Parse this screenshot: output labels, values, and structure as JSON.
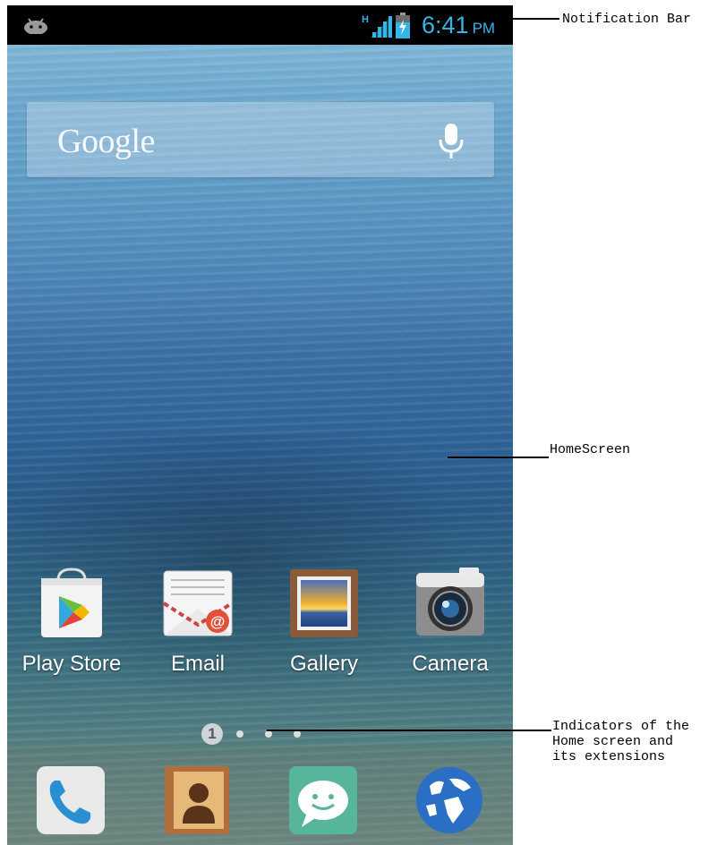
{
  "status_bar": {
    "time": "6:41",
    "ampm": "PM",
    "network_type": "H",
    "icons": [
      "android-notification-icon",
      "hspa-icon",
      "signal-icon",
      "battery-charging-icon"
    ],
    "accent_color": "#33b5e5"
  },
  "search_widget": {
    "logo": "Google",
    "icon": "mic-icon"
  },
  "apps": [
    {
      "label": "Play Store",
      "icon": "play-store-icon"
    },
    {
      "label": "Email",
      "icon": "email-icon"
    },
    {
      "label": "Gallery",
      "icon": "gallery-icon"
    },
    {
      "label": "Camera",
      "icon": "camera-icon"
    }
  ],
  "page_indicator": {
    "current_page": "1",
    "total_pages": 4
  },
  "dock": [
    {
      "icon": "phone-icon"
    },
    {
      "icon": "contacts-icon"
    },
    {
      "icon": "messaging-icon"
    },
    {
      "icon": "browser-icon"
    }
  ],
  "annotations": {
    "notification_bar": "Notification Bar",
    "homescreen": "HomeScreen",
    "indicators": "Indicators of the\nHome screen and\nits extensions"
  }
}
